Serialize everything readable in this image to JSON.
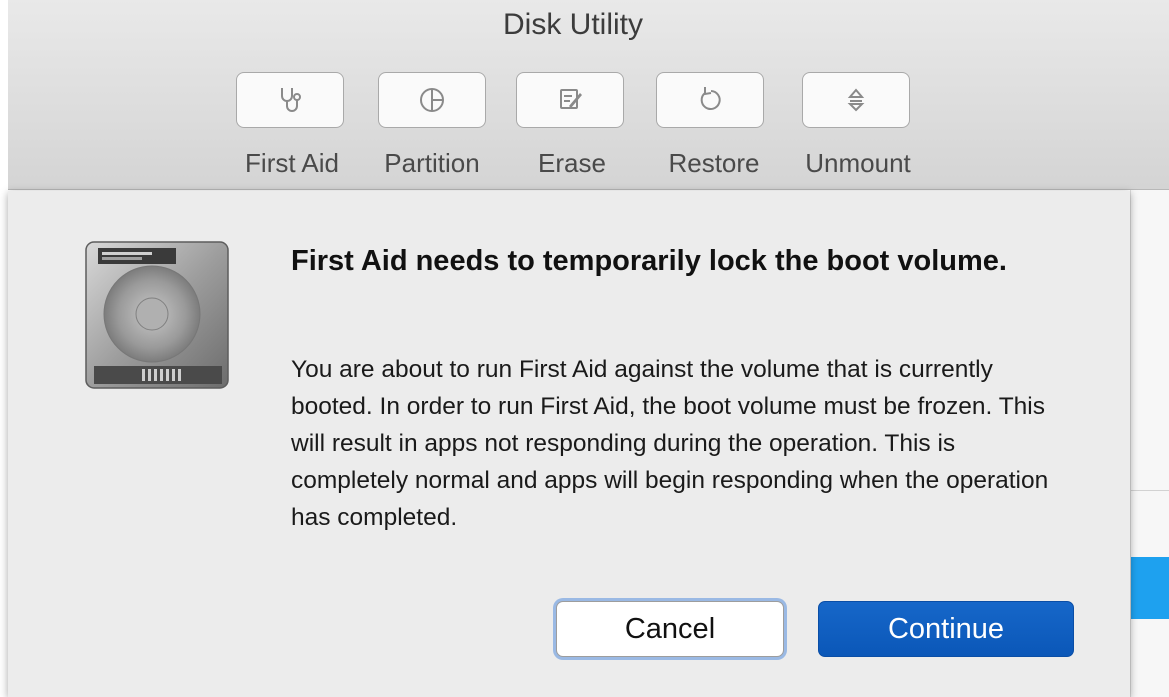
{
  "window": {
    "title": "Disk Utility"
  },
  "toolbar": {
    "items": [
      {
        "label": "First Aid",
        "icon": "stethoscope-icon"
      },
      {
        "label": "Partition",
        "icon": "pie-chart-icon"
      },
      {
        "label": "Erase",
        "icon": "erase-icon"
      },
      {
        "label": "Restore",
        "icon": "restore-icon"
      },
      {
        "label": "Unmount",
        "icon": "eject-icon"
      }
    ]
  },
  "dialog": {
    "icon": "hard-drive-icon",
    "headline": "First Aid needs to temporarily lock the boot volume.",
    "body": "You are about to run First Aid against the volume that is currently booted. In order to run First Aid, the boot volume must be frozen. This will result in apps not responding during the operation. This is completely normal and apps will begin responding when the operation has completed.",
    "cancel_label": "Cancel",
    "continue_label": "Continue"
  },
  "colors": {
    "accent": "#0b57b8",
    "selection_highlight": "#1ea1ef"
  }
}
